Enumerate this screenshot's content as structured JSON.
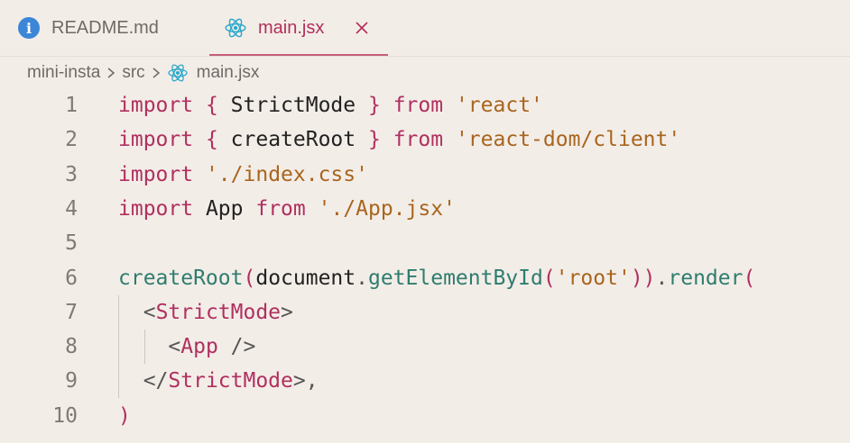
{
  "tabs": [
    {
      "label": "README.md",
      "icon": "info-icon",
      "active": false
    },
    {
      "label": "main.jsx",
      "icon": "react-icon",
      "active": true
    }
  ],
  "breadcrumb": {
    "items": [
      "mini-insta",
      "src",
      "main.jsx"
    ],
    "separator": ">"
  },
  "editor": {
    "line_numbers": [
      "1",
      "2",
      "3",
      "4",
      "5",
      "6",
      "7",
      "8",
      "9",
      "10"
    ],
    "lines": [
      {
        "t": [
          [
            "kw",
            "import"
          ],
          [
            "plain",
            " "
          ],
          [
            "brace",
            "{"
          ],
          [
            "plain",
            " StrictMode "
          ],
          [
            "brace",
            "}"
          ],
          [
            "plain",
            " "
          ],
          [
            "kw",
            "from"
          ],
          [
            "plain",
            " "
          ],
          [
            "str",
            "'react'"
          ]
        ]
      },
      {
        "t": [
          [
            "kw",
            "import"
          ],
          [
            "plain",
            " "
          ],
          [
            "brace",
            "{"
          ],
          [
            "plain",
            " createRoot "
          ],
          [
            "brace",
            "}"
          ],
          [
            "plain",
            " "
          ],
          [
            "kw",
            "from"
          ],
          [
            "plain",
            " "
          ],
          [
            "str",
            "'react-dom/client'"
          ]
        ]
      },
      {
        "t": [
          [
            "kw",
            "import"
          ],
          [
            "plain",
            " "
          ],
          [
            "str",
            "'./index.css'"
          ]
        ]
      },
      {
        "t": [
          [
            "kw",
            "import"
          ],
          [
            "plain",
            " App "
          ],
          [
            "kw",
            "from"
          ],
          [
            "plain",
            " "
          ],
          [
            "str",
            "'./App.jsx'"
          ]
        ]
      },
      {
        "t": []
      },
      {
        "t": [
          [
            "fn",
            "createRoot"
          ],
          [
            "brace",
            "("
          ],
          [
            "plain",
            "document"
          ],
          [
            "punc",
            "."
          ],
          [
            "fn",
            "getElementById"
          ],
          [
            "brace",
            "("
          ],
          [
            "str",
            "'root'"
          ],
          [
            "brace",
            "))"
          ],
          [
            "punc",
            "."
          ],
          [
            "fn",
            "render"
          ],
          [
            "brace",
            "("
          ]
        ]
      },
      {
        "t": [
          [
            "plain",
            "  "
          ],
          [
            "punc",
            "<"
          ],
          [
            "tag",
            "StrictMode"
          ],
          [
            "punc",
            ">"
          ]
        ]
      },
      {
        "t": [
          [
            "plain",
            "    "
          ],
          [
            "punc",
            "<"
          ],
          [
            "tag",
            "App"
          ],
          [
            "plain",
            " "
          ],
          [
            "punc",
            "/>"
          ]
        ]
      },
      {
        "t": [
          [
            "plain",
            "  "
          ],
          [
            "punc",
            "</"
          ],
          [
            "tag",
            "StrictMode"
          ],
          [
            "punc",
            ">,"
          ]
        ]
      },
      {
        "t": [
          [
            "brace",
            ")"
          ]
        ]
      }
    ]
  },
  "colors": {
    "background": "#f3ede8",
    "keyword": "#b03060",
    "string": "#a8651e",
    "function": "#2e7d6f",
    "tab_active": "#b0305a"
  }
}
